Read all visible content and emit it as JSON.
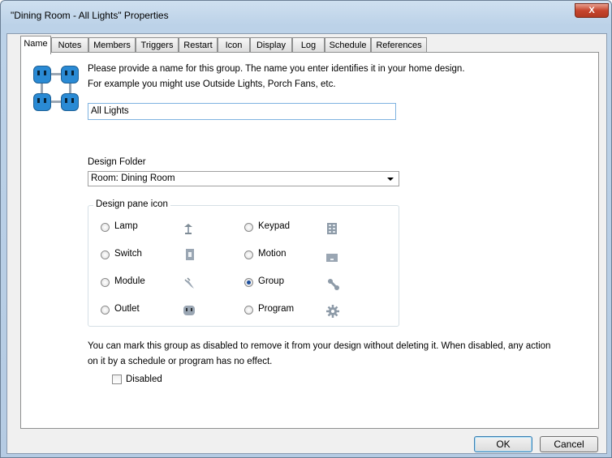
{
  "window": {
    "title": "\"Dining Room - All Lights\" Properties",
    "close_label": "X"
  },
  "tabs": [
    "Name",
    "Notes",
    "Members",
    "Triggers",
    "Restart",
    "Icon",
    "Display",
    "Log",
    "Schedule",
    "References"
  ],
  "active_tab": "Name",
  "name_section": {
    "instruction_line1": "Please provide a name for this group.  The name you enter identifies it in your home design.",
    "instruction_line2": "For example you might use Outside Lights, Porch Fans, etc.",
    "name_value": "All Lights"
  },
  "design_folder": {
    "label": "Design Folder",
    "selected": "Room: Dining Room"
  },
  "design_pane_icon": {
    "legend": "Design pane icon",
    "options": [
      {
        "label": "Lamp",
        "icon": "lamp-icon",
        "checked": false
      },
      {
        "label": "Keypad",
        "icon": "keypad-icon",
        "checked": false
      },
      {
        "label": "Switch",
        "icon": "switch-icon",
        "checked": false
      },
      {
        "label": "Motion",
        "icon": "motion-icon",
        "checked": false
      },
      {
        "label": "Module",
        "icon": "plug-module-icon",
        "checked": false
      },
      {
        "label": "Group",
        "icon": "group-link-icon",
        "checked": true
      },
      {
        "label": "Outlet",
        "icon": "outlet-icon",
        "checked": false
      },
      {
        "label": "Program",
        "icon": "gear-icon",
        "checked": false
      }
    ]
  },
  "disable_section": {
    "text_line1": "You can mark this group as disabled to remove it from your design without deleting it.  When disabled, any action",
    "text_line2": "on it by a schedule or program has no effect.",
    "checkbox_label": "Disabled",
    "checked": false
  },
  "buttons": {
    "ok": "OK",
    "cancel": "Cancel"
  },
  "colors": {
    "accent": "#2a8ad4",
    "title_bar": "#bcd2e8",
    "close_button": "#c6452e"
  }
}
